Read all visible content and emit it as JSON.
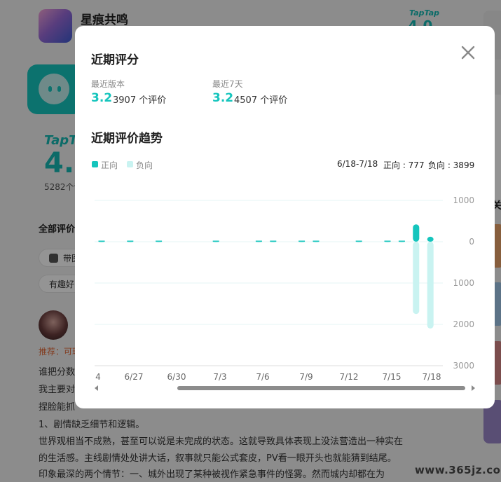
{
  "background": {
    "app_title": "星痕共鸣",
    "taptap_logo_small": "TapTap",
    "taptap_score_small": "4.0",
    "taptap_logo_big": "TapTap",
    "score_big": "4.0",
    "review_count": "5282个评",
    "all_reviews_label": "全部评价",
    "chip_1_label": "带图",
    "chip_2_label": "有趣好",
    "recommend_label": "推荐：可玩",
    "body_lines": [
      "谁把分数",
      "我主要对",
      "捏脸能抓",
      "1、剧情缺乏细节和逻辑。",
      "世界观相当不成熟，甚至可以说是未完成的状态。这就导致具体表现上没法营造出一种实在",
      "的生活感。主线剧情处处讲大话，叙事就只能公式套皮，PV看一眼开头也就能猜到结尾。",
      "印象最深的两个情节：一、城外出现了某种被视作紧急事件的怪雾。然而城内却都在为"
    ],
    "right_label": "关",
    "watermark": "www.365jz.com"
  },
  "modal": {
    "recent_rating_title": "近期评分",
    "stats": [
      {
        "label": "最近版本",
        "score": "3.2",
        "count": "3907 个评价"
      },
      {
        "label": "最近7天",
        "score": "3.2",
        "count": "4507 个评价"
      }
    ],
    "trend_title": "近期评价趋势",
    "legend": {
      "positive": "正向",
      "negative": "负向"
    },
    "summary": {
      "range": "6/18-7/18",
      "positive": "正向 : 777",
      "negative": "负向 : 3899"
    },
    "close_icon": "close-icon"
  },
  "colors": {
    "accent": "#15c5bd",
    "positive": "#15c5bd",
    "negative": "#c9f3f1",
    "overlay": "rgba(0,0,0,0.42)"
  },
  "chart_data": {
    "type": "bar",
    "x_ticks": [
      "4",
      "6/27",
      "6/30",
      "7/3",
      "7/6",
      "7/9",
      "7/12",
      "7/15",
      "7/18"
    ],
    "y_ticks": [
      "1000",
      "0",
      "1000",
      "2000",
      "3000"
    ],
    "ylim": [
      -3000,
      1000
    ],
    "grid": true,
    "legend": "top-left",
    "series": [
      {
        "name": "正向",
        "x": [
          "6/24",
          "6/26",
          "6/28",
          "7/2",
          "7/5",
          "7/6",
          "7/8",
          "7/9",
          "7/12",
          "7/14",
          "7/15",
          "7/16",
          "7/17"
        ],
        "values": [
          5,
          5,
          5,
          5,
          5,
          5,
          5,
          5,
          5,
          5,
          10,
          420,
          120
        ]
      },
      {
        "name": "负向",
        "x": [
          "6/24",
          "6/26",
          "6/28",
          "7/2",
          "7/5",
          "7/6",
          "7/8",
          "7/9",
          "7/12",
          "7/14",
          "7/15",
          "7/16",
          "7/17"
        ],
        "values": [
          -5,
          -5,
          -5,
          -5,
          -5,
          -5,
          -5,
          -5,
          -5,
          -5,
          -10,
          -1750,
          -2100
        ]
      }
    ]
  }
}
